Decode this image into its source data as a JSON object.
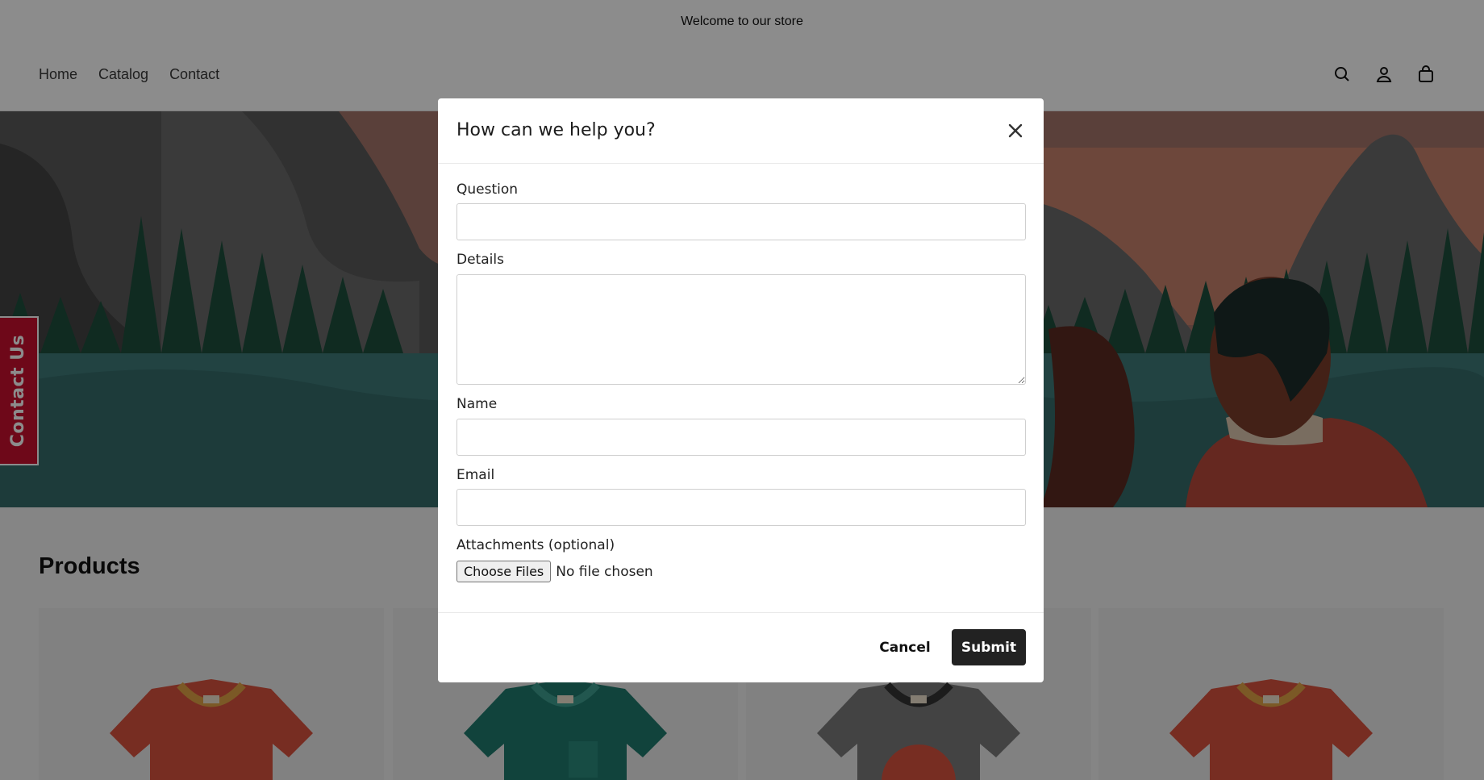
{
  "announcement": {
    "text": "Welcome to our store"
  },
  "header": {
    "nav": [
      "Home",
      "Catalog",
      "Contact"
    ],
    "icons": [
      "search-icon",
      "account-icon",
      "cart-icon"
    ]
  },
  "sections": {
    "products_title": "Products"
  },
  "contact_tab": {
    "label": "Contact Us",
    "color": "#c8102e"
  },
  "modal": {
    "title": "How can we help you?",
    "fields": {
      "question_label": "Question",
      "question_value": "",
      "details_label": "Details",
      "details_value": "",
      "name_label": "Name",
      "name_value": "",
      "email_label": "Email",
      "email_value": "",
      "attachments_label": "Attachments (optional)",
      "choose_files_label": "Choose Files",
      "file_status": "No file chosen"
    },
    "cancel_label": "Cancel",
    "submit_label": "Submit"
  },
  "colors": {
    "submit_bg": "#222222",
    "overlay": "rgba(0,0,0,0.45)"
  }
}
